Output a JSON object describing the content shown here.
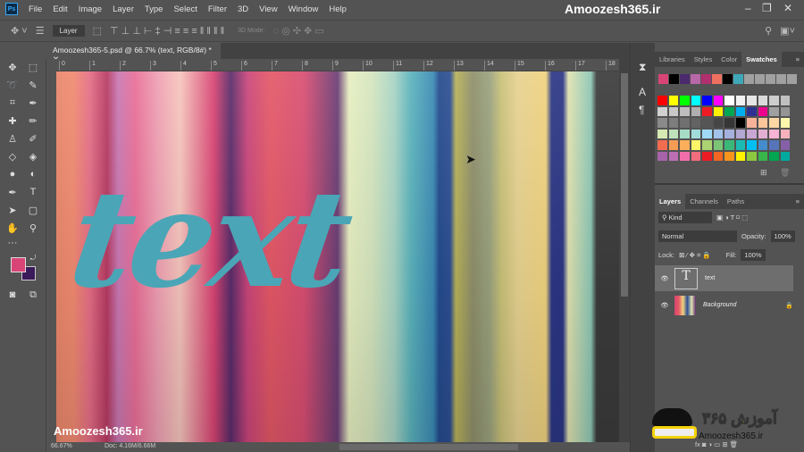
{
  "app": {
    "title": "Amoozesh365.ir",
    "logo": "Ps"
  },
  "menu": [
    "File",
    "Edit",
    "Image",
    "Layer",
    "Type",
    "Select",
    "Filter",
    "3D",
    "View",
    "Window",
    "Help"
  ],
  "options": {
    "target": "Layer",
    "mode_label": "3D Mode:"
  },
  "document": {
    "tab": "Amoozesh365-5.psd @ 66.7% (text, RGB/8#) *",
    "ruler": [
      "0",
      "1",
      "2",
      "3",
      "4",
      "5",
      "6",
      "7",
      "8",
      "9",
      "10",
      "11",
      "12",
      "13",
      "14",
      "15",
      "16",
      "17",
      "18"
    ],
    "text_layer": "text",
    "watermark": "Amoozesh365.ir"
  },
  "status": {
    "zoom": "66.67%",
    "doc": "Doc: 4.16M/6.66M"
  },
  "swatches_panel": {
    "tabs": [
      "Libraries",
      "Styles",
      "Color",
      "Swatches"
    ],
    "recent": [
      "#d94477",
      "#000000",
      "#4b2a6e",
      "#b868a8",
      "#b0306e",
      "#f07060",
      "#000000",
      "#3fa8b8",
      "#a0a0a0",
      "#a0a0a0",
      "#a0a0a0",
      "#a0a0a0",
      "#a0a0a0"
    ],
    "grid": [
      "#ff0000",
      "#ffff00",
      "#00ff00",
      "#00ffff",
      "#0000ff",
      "#ff00ff",
      "#ffffff",
      "#f2f2f2",
      "#e6e6e6",
      "#dadada",
      "#cdcdcd",
      "#c0c0c0",
      "#d0d0d0",
      "#c8c8c8",
      "#bdbdbd",
      "#b0b0b0",
      "#ed1c24",
      "#fff200",
      "#00a651",
      "#00aeef",
      "#2e3192",
      "#ec008c",
      "#a0a0a0",
      "#959595",
      "#8a8a8a",
      "#7d7d7d",
      "#707070",
      "#636363",
      "#555555",
      "#464646",
      "#363636",
      "#000000",
      "#f7b299",
      "#fbc59a",
      "#fdd8a4",
      "#fff7ac",
      "#d7e9b2",
      "#bfe2bc",
      "#a6dcc6",
      "#a1dbdc",
      "#9fd9f6",
      "#a3c2ea",
      "#a5b0dd",
      "#b3a7d3",
      "#c8a7d2",
      "#e3aed2",
      "#f7b3d3",
      "#f6b1bc",
      "#f26c4f",
      "#f69c55",
      "#fbae5c",
      "#fff568",
      "#acd372",
      "#7cc576",
      "#3bb878",
      "#1bbbb4",
      "#00bff3",
      "#448ccb",
      "#5674b9",
      "#8560a8",
      "#a763a9",
      "#bd6fb4",
      "#f06eaa",
      "#f26d7d",
      "#ed1c24",
      "#f26522",
      "#f7941d",
      "#fff200",
      "#8dc63f",
      "#39b54a",
      "#00a651",
      "#00a99d"
    ]
  },
  "layers_panel": {
    "tabs": [
      "Layers",
      "Channels",
      "Paths"
    ],
    "filter": "Kind",
    "blend": "Normal",
    "opacity_label": "Opacity:",
    "opacity": "100%",
    "lock_label": "Lock:",
    "fill_label": "Fill:",
    "fill": "100%",
    "layers": [
      {
        "name": "text",
        "type": "T"
      },
      {
        "name": "Background"
      }
    ]
  },
  "brand": {
    "persian": "آموزش ۳۶۵",
    "url": "Amoozesh365.ir"
  },
  "colors": {
    "foreground": "#d94477",
    "background": "#3a1a5a"
  }
}
